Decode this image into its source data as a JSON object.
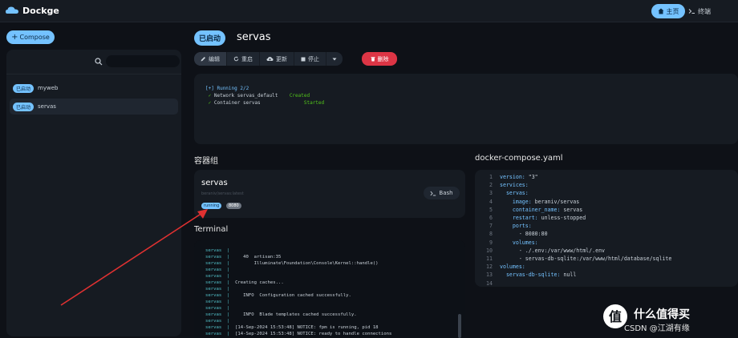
{
  "app": {
    "title": "Dockge"
  },
  "topnav": {
    "home_label": "主页",
    "terminal_label": "终端"
  },
  "sidebar": {
    "compose_label": "Compose",
    "search_placeholder": "",
    "stacks": [
      {
        "badge": "已启动",
        "name": "myweb"
      },
      {
        "badge": "已启动",
        "name": "servas"
      }
    ]
  },
  "stack": {
    "status": "已启动",
    "name": "servas",
    "toolbar": {
      "edit_label": "编辑",
      "restart_label": "重启",
      "update_label": "更新",
      "stop_label": "停止",
      "delete_label": "删除"
    },
    "log_lines": [
      {
        "mark": "[+]",
        "text": "Running 2/2",
        "status": ""
      },
      {
        "mark": "✓",
        "text": "Network servas_default",
        "status": "Created"
      },
      {
        "mark": "✓",
        "text": "Container servas",
        "status": "Started"
      }
    ]
  },
  "containers": {
    "heading": "容器组",
    "card": {
      "name": "servas",
      "image": "beraniv/servas:latest",
      "state_badge": "running",
      "port_badge": "8080",
      "bash_label": "Bash"
    }
  },
  "terminal": {
    "heading": "Terminal",
    "lines": [
      {
        "prefix": "servas",
        "text": ""
      },
      {
        "prefix": "servas",
        "text": "   40  artisan:35"
      },
      {
        "prefix": "servas",
        "text": "       Illuminate\\Foundation\\Console\\Kernel::handle()"
      },
      {
        "prefix": "servas",
        "text": ""
      },
      {
        "prefix": "servas",
        "text": ""
      },
      {
        "prefix": "servas",
        "text": "Creating caches..."
      },
      {
        "prefix": "servas",
        "text": ""
      },
      {
        "prefix": "servas",
        "text": "   INFO  Configuration cached successfully."
      },
      {
        "prefix": "servas",
        "text": ""
      },
      {
        "prefix": "servas",
        "text": ""
      },
      {
        "prefix": "servas",
        "text": "   INFO  Blade templates cached successfully."
      },
      {
        "prefix": "servas",
        "text": ""
      },
      {
        "prefix": "servas",
        "text": "[14-Sep-2024 15:53:48] NOTICE: fpm is running, pid 18"
      },
      {
        "prefix": "servas",
        "text": "[14-Sep-2024 15:53:48] NOTICE: ready to handle connections"
      }
    ]
  },
  "yaml": {
    "heading": "docker-compose.yaml",
    "lines": [
      {
        "n": "1",
        "key": "version:",
        "val": " \"3\""
      },
      {
        "n": "2",
        "key": "services:",
        "val": ""
      },
      {
        "n": "3",
        "key": "  servas:",
        "val": ""
      },
      {
        "n": "4",
        "key": "    image:",
        "val": " beraniv/servas"
      },
      {
        "n": "5",
        "key": "    container_name:",
        "val": " servas"
      },
      {
        "n": "6",
        "key": "    restart:",
        "val": " unless-stopped"
      },
      {
        "n": "7",
        "key": "    ports:",
        "val": ""
      },
      {
        "n": "8",
        "key": "",
        "val": "      - 8080:80"
      },
      {
        "n": "9",
        "key": "    volumes:",
        "val": ""
      },
      {
        "n": "10",
        "key": "",
        "val": "      - ./.env:/var/www/html/.env"
      },
      {
        "n": "11",
        "key": "",
        "val": "      - servas-db-sqlite:/var/www/html/database/sqlite"
      },
      {
        "n": "12",
        "key": "volumes:",
        "val": ""
      },
      {
        "n": "13",
        "key": "  servas-db-sqlite:",
        "val": " null"
      },
      {
        "n": "14",
        "key": "",
        "val": ""
      }
    ]
  },
  "watermark": {
    "text": "什么值得买",
    "sub": "CSDN @江湖有缘"
  },
  "colors": {
    "accent": "#74c2ff",
    "danger": "#dc3545",
    "bg": "#0e1117",
    "panel": "#161b22",
    "success": "#52c41a",
    "annotation": "#e03131"
  }
}
